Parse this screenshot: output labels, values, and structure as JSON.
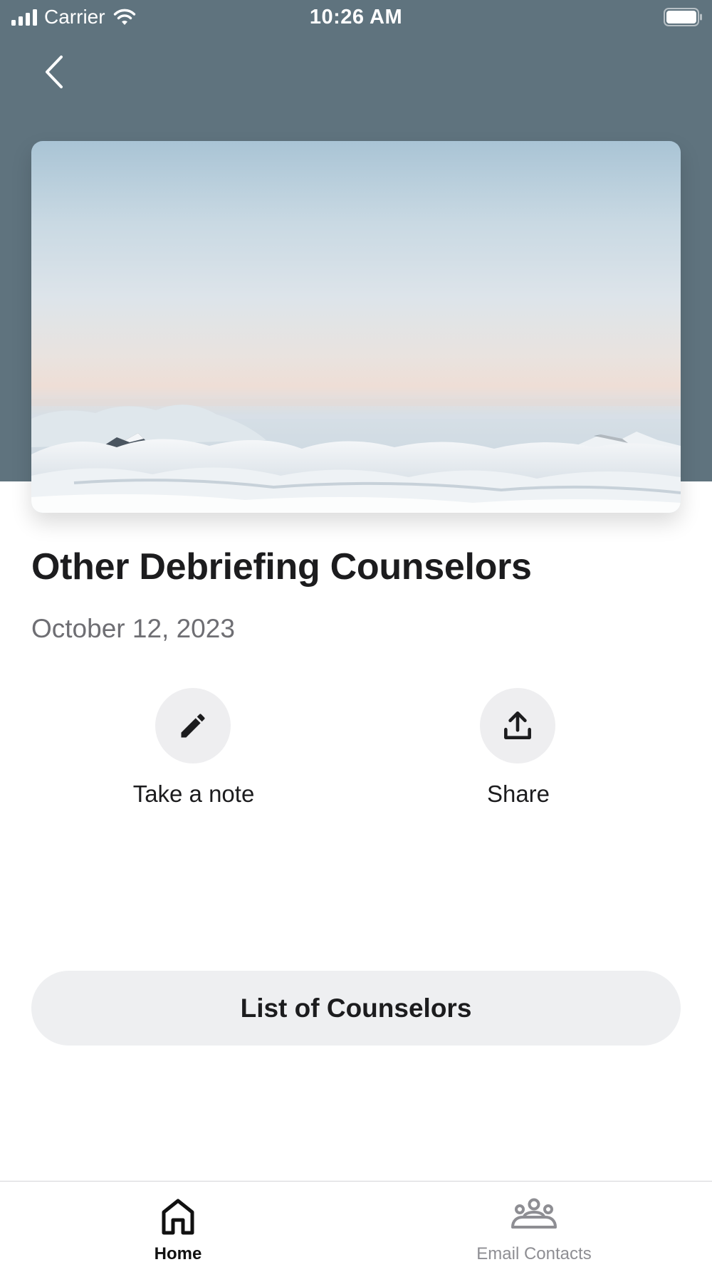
{
  "status_bar": {
    "carrier": "Carrier",
    "time": "10:26 AM",
    "icons": [
      "signal-icon",
      "wifi-icon",
      "battery-icon"
    ]
  },
  "nav": {
    "back_icon": "chevron-left-icon"
  },
  "hero": {
    "image": "clouds-and-mountain-peaks-landscape"
  },
  "content": {
    "title": "Other Debriefing Counselors",
    "date": "October 12, 2023"
  },
  "actions": [
    {
      "label": "Take a note",
      "icon": "pencil-icon"
    },
    {
      "label": "Share",
      "icon": "share-upload-icon"
    }
  ],
  "primary_button": {
    "label": "List of Counselors"
  },
  "tab_bar": {
    "tabs": [
      {
        "label": "Home",
        "icon": "home-icon",
        "active": true
      },
      {
        "label": "Email Contacts",
        "icon": "group-icon",
        "active": false
      }
    ]
  },
  "colors": {
    "header_background": "#5f737e",
    "button_background": "#eeeff1",
    "title_text": "#1c1c1e",
    "secondary_text": "#6e6e73",
    "inactive_tab": "#8e8e93"
  }
}
